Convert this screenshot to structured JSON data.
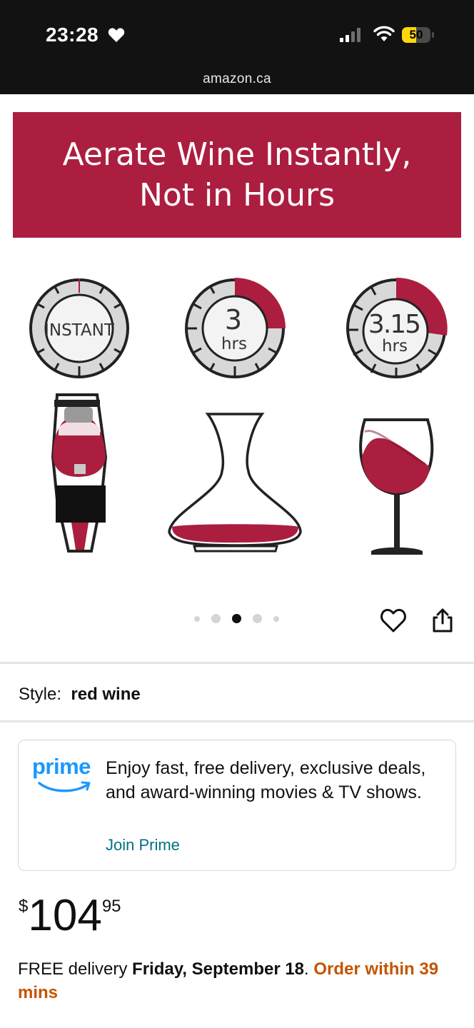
{
  "status_bar": {
    "time": "23:28",
    "battery_percent": "50",
    "battery_level": 0.5,
    "url": "amazon.ca"
  },
  "banner": {
    "line1": "Aerate Wine Instantly,",
    "line2": "Not in Hours",
    "color": "#ab1e40"
  },
  "timers": [
    {
      "label": "INSTANT",
      "unit": ""
    },
    {
      "label": "3",
      "unit": "hrs"
    },
    {
      "label": "3.15",
      "unit": "hrs"
    }
  ],
  "carousel": {
    "count": 5,
    "active": 2
  },
  "style": {
    "label": "Style:",
    "value": "red wine"
  },
  "prime": {
    "logo": "prime",
    "text": "Enjoy fast, free delivery, exclusive deals, and award-winning movies & TV shows.",
    "link": "Join Prime"
  },
  "price": {
    "currency": "$",
    "whole": "104",
    "fraction": "95"
  },
  "delivery": {
    "prefix": "FREE delivery ",
    "date": "Friday, September 18",
    "suffix": ". ",
    "order_cutoff": "Order within 39 mins"
  }
}
